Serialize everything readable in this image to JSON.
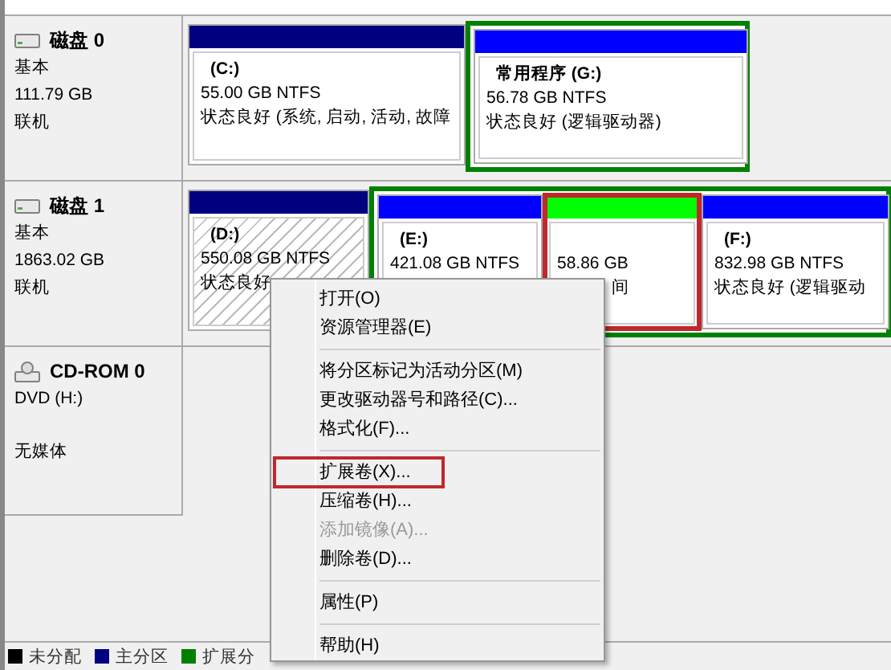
{
  "disks": [
    {
      "name": "磁盘 0",
      "type": "基本",
      "size": "111.79 GB",
      "status": "联机",
      "partitions": [
        {
          "kind": "primary",
          "label": "(C:)",
          "size": "55.00 GB NTFS",
          "status": "状态良好 (系统, 启动, 活动, 故障",
          "selected": false,
          "highlighted": false
        },
        {
          "kind": "extended",
          "partitions": [
            {
              "kind": "logical",
              "label": "常用程序  (G:)",
              "size": "56.78 GB NTFS",
              "status": "状态良好 (逻辑驱动器)",
              "selected": false,
              "highlighted": false
            }
          ]
        }
      ]
    },
    {
      "name": "磁盘 1",
      "type": "基本",
      "size": "1863.02 GB",
      "status": "联机",
      "partitions": [
        {
          "kind": "primary",
          "label": "(D:)",
          "size": "550.08 GB NTFS",
          "status": "状态良好",
          "selected": true,
          "highlighted": false
        },
        {
          "kind": "extended",
          "partitions": [
            {
              "kind": "logical",
              "label": "(E:)",
              "size": "421.08 GB NTFS",
              "selected": false,
              "highlighted": false
            },
            {
              "kind": "free",
              "size": "58.86 GB",
              "status": "间",
              "selected": false,
              "highlighted": true
            },
            {
              "kind": "logical",
              "label": "(F:)",
              "size": "832.98 GB NTFS",
              "status": "状态良好 (逻辑驱动",
              "selected": false,
              "highlighted": false
            }
          ]
        }
      ]
    }
  ],
  "cdrom": {
    "name": "CD-ROM 0",
    "drive": "DVD (H:)",
    "media": "无媒体"
  },
  "legend": [
    {
      "label": "未分配",
      "color": "#000000"
    },
    {
      "label": "主分区",
      "color": "#000080"
    },
    {
      "label": "扩展分",
      "color": "#008000"
    }
  ],
  "context_menu": [
    {
      "kind": "item",
      "label": "打开(O)",
      "disabled": false,
      "highlighted": false
    },
    {
      "kind": "item",
      "label": "资源管理器(E)",
      "disabled": false,
      "highlighted": false
    },
    {
      "kind": "separator"
    },
    {
      "kind": "item",
      "label": "将分区标记为活动分区(M)",
      "disabled": false,
      "highlighted": false
    },
    {
      "kind": "item",
      "label": "更改驱动器号和路径(C)...",
      "disabled": false,
      "highlighted": false
    },
    {
      "kind": "item",
      "label": "格式化(F)...",
      "disabled": false,
      "highlighted": false
    },
    {
      "kind": "separator"
    },
    {
      "kind": "item",
      "label": "扩展卷(X)...",
      "disabled": false,
      "highlighted": true
    },
    {
      "kind": "item",
      "label": "压缩卷(H)...",
      "disabled": false,
      "highlighted": false
    },
    {
      "kind": "item",
      "label": "添加镜像(A)...",
      "disabled": true,
      "highlighted": false
    },
    {
      "kind": "item",
      "label": "删除卷(D)...",
      "disabled": false,
      "highlighted": false
    },
    {
      "kind": "separator"
    },
    {
      "kind": "item",
      "label": "属性(P)",
      "disabled": false,
      "highlighted": false
    },
    {
      "kind": "separator"
    },
    {
      "kind": "item",
      "label": "帮助(H)",
      "disabled": false,
      "highlighted": false
    }
  ]
}
